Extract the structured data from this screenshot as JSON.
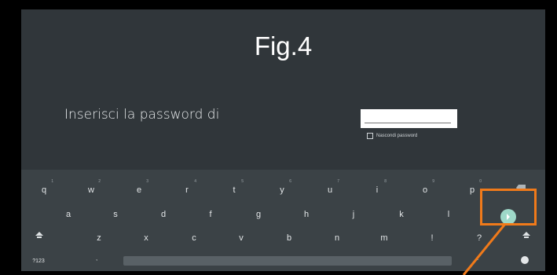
{
  "figure": {
    "label": "Fig.4"
  },
  "dialog": {
    "prompt": "Inserisci la password di",
    "hide_password_label": "Nascondi password"
  },
  "keyboard": {
    "row1": [
      {
        "key": "q",
        "hint": "1"
      },
      {
        "key": "w",
        "hint": "2"
      },
      {
        "key": "e",
        "hint": "3"
      },
      {
        "key": "r",
        "hint": "4"
      },
      {
        "key": "t",
        "hint": "5"
      },
      {
        "key": "y",
        "hint": "6"
      },
      {
        "key": "u",
        "hint": "7"
      },
      {
        "key": "i",
        "hint": "8"
      },
      {
        "key": "o",
        "hint": "9"
      },
      {
        "key": "p",
        "hint": "0"
      }
    ],
    "row2": [
      "a",
      "s",
      "d",
      "f",
      "g",
      "h",
      "j",
      "k",
      "l"
    ],
    "row3": [
      "z",
      "x",
      "c",
      "v",
      "b",
      "n",
      "m",
      "!",
      "?"
    ],
    "symbols_label": "?123",
    "comma": ",",
    "period": "."
  },
  "annotation": {
    "color": "#f07a1a"
  }
}
